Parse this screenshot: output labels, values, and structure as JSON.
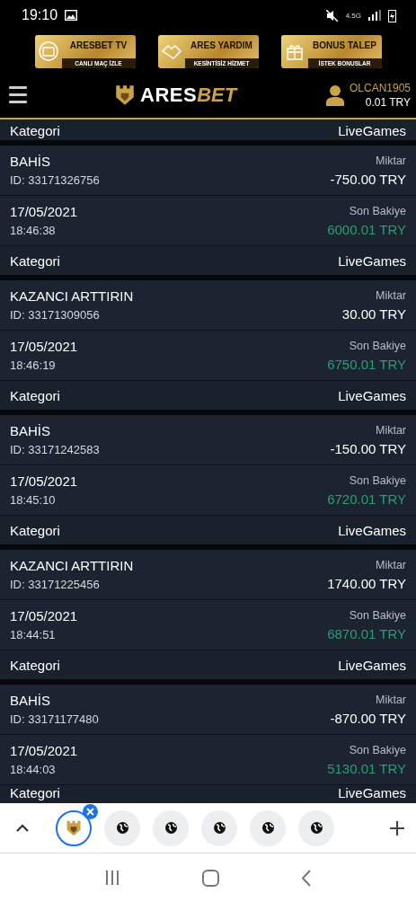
{
  "status_bar": {
    "time": "19:10",
    "network": "4.5G"
  },
  "banners": [
    {
      "title": "ARESBET TV",
      "subtitle": "CANLI MAÇ İZLE",
      "kind": "tv"
    },
    {
      "title": "ARES YARDIM",
      "subtitle": "KESİNTİSİZ HİZMET",
      "kind": "help"
    },
    {
      "title": "BONUS TALEP",
      "subtitle": "İSTEK BONUSLAR",
      "kind": "gift"
    }
  ],
  "header": {
    "logo_main": "ARES",
    "logo_accent": "BET",
    "username": "OLCAN1905",
    "balance": "0.01 TRY"
  },
  "top_partial": {
    "category_label": "Kategori",
    "category": "LiveGames"
  },
  "transactions": [
    {
      "type": "BAHİS",
      "id": "ID: 33171326756",
      "amount_label": "Miktar",
      "amount": "-750.00 TRY",
      "date": "17/05/2021",
      "time": "18:46:38",
      "balance_label": "Son Bakiye",
      "balance": "6000.01 TRY",
      "category_label": "Kategori",
      "category": "LiveGames"
    },
    {
      "type": "KAZANCI ARTTIRIN",
      "id": "ID: 33171309056",
      "amount_label": "Miktar",
      "amount": "30.00 TRY",
      "date": "17/05/2021",
      "time": "18:46:19",
      "balance_label": "Son Bakiye",
      "balance": "6750.01 TRY",
      "category_label": "Kategori",
      "category": "LiveGames"
    },
    {
      "type": "BAHİS",
      "id": "ID: 33171242583",
      "amount_label": "Miktar",
      "amount": "-150.00 TRY",
      "date": "17/05/2021",
      "time": "18:45:10",
      "balance_label": "Son Bakiye",
      "balance": "6720.01 TRY",
      "category_label": "Kategori",
      "category": "LiveGames"
    },
    {
      "type": "KAZANCI ARTTIRIN",
      "id": "ID: 33171225456",
      "amount_label": "Miktar",
      "amount": "1740.00 TRY",
      "date": "17/05/2021",
      "time": "18:44:51",
      "balance_label": "Son Bakiye",
      "balance": "6870.01 TRY",
      "category_label": "Kategori",
      "category": "LiveGames"
    },
    {
      "type": "BAHİS",
      "id": "ID: 33171177480",
      "amount_label": "Miktar",
      "amount": "-870.00 TRY",
      "date": "17/05/2021",
      "time": "18:44:03",
      "balance_label": "Son Bakiye",
      "balance": "5130.01 TRY",
      "category_label": "Kategori",
      "category": "LiveGames"
    }
  ],
  "browser_tabs": [
    {
      "kind": "site",
      "selected": true
    },
    {
      "kind": "globe",
      "selected": false
    },
    {
      "kind": "globe",
      "selected": false
    },
    {
      "kind": "globe",
      "selected": false
    },
    {
      "kind": "globe",
      "selected": false
    },
    {
      "kind": "globe",
      "selected": false
    }
  ]
}
